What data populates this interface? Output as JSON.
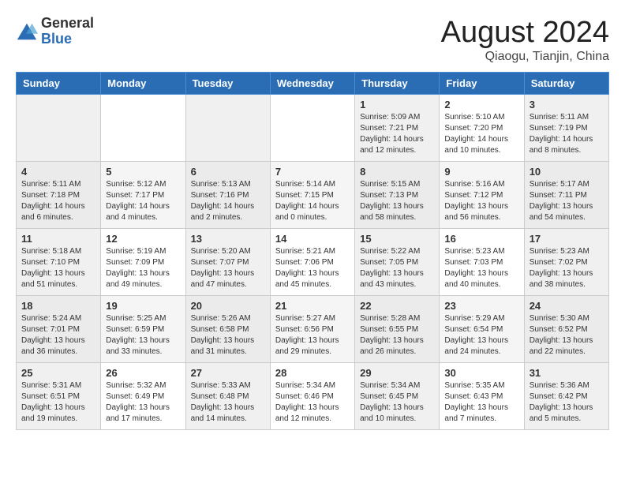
{
  "logo": {
    "general": "General",
    "blue": "Blue"
  },
  "title": "August 2024",
  "subtitle": "Qiaogu, Tianjin, China",
  "headers": [
    "Sunday",
    "Monday",
    "Tuesday",
    "Wednesday",
    "Thursday",
    "Friday",
    "Saturday"
  ],
  "weeks": [
    [
      {
        "day": "",
        "info": ""
      },
      {
        "day": "",
        "info": ""
      },
      {
        "day": "",
        "info": ""
      },
      {
        "day": "",
        "info": ""
      },
      {
        "day": "1",
        "info": "Sunrise: 5:09 AM\nSunset: 7:21 PM\nDaylight: 14 hours\nand 12 minutes."
      },
      {
        "day": "2",
        "info": "Sunrise: 5:10 AM\nSunset: 7:20 PM\nDaylight: 14 hours\nand 10 minutes."
      },
      {
        "day": "3",
        "info": "Sunrise: 5:11 AM\nSunset: 7:19 PM\nDaylight: 14 hours\nand 8 minutes."
      }
    ],
    [
      {
        "day": "4",
        "info": "Sunrise: 5:11 AM\nSunset: 7:18 PM\nDaylight: 14 hours\nand 6 minutes."
      },
      {
        "day": "5",
        "info": "Sunrise: 5:12 AM\nSunset: 7:17 PM\nDaylight: 14 hours\nand 4 minutes."
      },
      {
        "day": "6",
        "info": "Sunrise: 5:13 AM\nSunset: 7:16 PM\nDaylight: 14 hours\nand 2 minutes."
      },
      {
        "day": "7",
        "info": "Sunrise: 5:14 AM\nSunset: 7:15 PM\nDaylight: 14 hours\nand 0 minutes."
      },
      {
        "day": "8",
        "info": "Sunrise: 5:15 AM\nSunset: 7:13 PM\nDaylight: 13 hours\nand 58 minutes."
      },
      {
        "day": "9",
        "info": "Sunrise: 5:16 AM\nSunset: 7:12 PM\nDaylight: 13 hours\nand 56 minutes."
      },
      {
        "day": "10",
        "info": "Sunrise: 5:17 AM\nSunset: 7:11 PM\nDaylight: 13 hours\nand 54 minutes."
      }
    ],
    [
      {
        "day": "11",
        "info": "Sunrise: 5:18 AM\nSunset: 7:10 PM\nDaylight: 13 hours\nand 51 minutes."
      },
      {
        "day": "12",
        "info": "Sunrise: 5:19 AM\nSunset: 7:09 PM\nDaylight: 13 hours\nand 49 minutes."
      },
      {
        "day": "13",
        "info": "Sunrise: 5:20 AM\nSunset: 7:07 PM\nDaylight: 13 hours\nand 47 minutes."
      },
      {
        "day": "14",
        "info": "Sunrise: 5:21 AM\nSunset: 7:06 PM\nDaylight: 13 hours\nand 45 minutes."
      },
      {
        "day": "15",
        "info": "Sunrise: 5:22 AM\nSunset: 7:05 PM\nDaylight: 13 hours\nand 43 minutes."
      },
      {
        "day": "16",
        "info": "Sunrise: 5:23 AM\nSunset: 7:03 PM\nDaylight: 13 hours\nand 40 minutes."
      },
      {
        "day": "17",
        "info": "Sunrise: 5:23 AM\nSunset: 7:02 PM\nDaylight: 13 hours\nand 38 minutes."
      }
    ],
    [
      {
        "day": "18",
        "info": "Sunrise: 5:24 AM\nSunset: 7:01 PM\nDaylight: 13 hours\nand 36 minutes."
      },
      {
        "day": "19",
        "info": "Sunrise: 5:25 AM\nSunset: 6:59 PM\nDaylight: 13 hours\nand 33 minutes."
      },
      {
        "day": "20",
        "info": "Sunrise: 5:26 AM\nSunset: 6:58 PM\nDaylight: 13 hours\nand 31 minutes."
      },
      {
        "day": "21",
        "info": "Sunrise: 5:27 AM\nSunset: 6:56 PM\nDaylight: 13 hours\nand 29 minutes."
      },
      {
        "day": "22",
        "info": "Sunrise: 5:28 AM\nSunset: 6:55 PM\nDaylight: 13 hours\nand 26 minutes."
      },
      {
        "day": "23",
        "info": "Sunrise: 5:29 AM\nSunset: 6:54 PM\nDaylight: 13 hours\nand 24 minutes."
      },
      {
        "day": "24",
        "info": "Sunrise: 5:30 AM\nSunset: 6:52 PM\nDaylight: 13 hours\nand 22 minutes."
      }
    ],
    [
      {
        "day": "25",
        "info": "Sunrise: 5:31 AM\nSunset: 6:51 PM\nDaylight: 13 hours\nand 19 minutes."
      },
      {
        "day": "26",
        "info": "Sunrise: 5:32 AM\nSunset: 6:49 PM\nDaylight: 13 hours\nand 17 minutes."
      },
      {
        "day": "27",
        "info": "Sunrise: 5:33 AM\nSunset: 6:48 PM\nDaylight: 13 hours\nand 14 minutes."
      },
      {
        "day": "28",
        "info": "Sunrise: 5:34 AM\nSunset: 6:46 PM\nDaylight: 13 hours\nand 12 minutes."
      },
      {
        "day": "29",
        "info": "Sunrise: 5:34 AM\nSunset: 6:45 PM\nDaylight: 13 hours\nand 10 minutes."
      },
      {
        "day": "30",
        "info": "Sunrise: 5:35 AM\nSunset: 6:43 PM\nDaylight: 13 hours\nand 7 minutes."
      },
      {
        "day": "31",
        "info": "Sunrise: 5:36 AM\nSunset: 6:42 PM\nDaylight: 13 hours\nand 5 minutes."
      }
    ]
  ]
}
